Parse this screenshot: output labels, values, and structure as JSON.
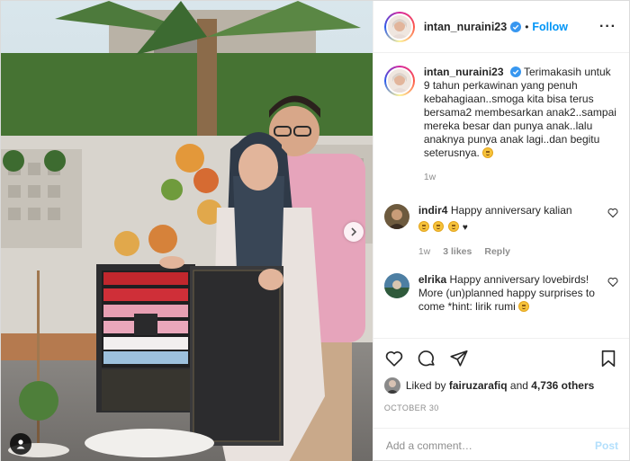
{
  "post": {
    "username": "intan_nuraini23",
    "follow_label": "Follow",
    "dot": "•",
    "more_label": "···",
    "caption": "Terimakasih untuk 9 tahun perkawinan yang penuh kebahagiaan..smoga kita bisa terus bersama2 membesarkan anak2..sampai mereka besar dan punya anak..lalu anaknya punya anak lagi..dan begitu seterusnya.",
    "caption_age": "1w",
    "likes_prefix": "Liked by",
    "likes_user": "fairuzarafiq",
    "likes_and": "and",
    "likes_count": "4,736 others",
    "date": "OCTOBER 30",
    "comment_placeholder": "Add a comment…",
    "post_label": "Post"
  },
  "comments": [
    {
      "username": "indir4",
      "text": "Happy anniversary kalian",
      "age": "1w",
      "likes": "3 likes",
      "reply": "Reply"
    },
    {
      "username": "elrika",
      "text": "Happy anniversary lovebirds! More (un)planned happy surprises to come *hint: lirik rumi"
    }
  ],
  "icons": {
    "verified": "verified-badge-icon",
    "heart": "heart-icon",
    "comment": "comment-icon",
    "share": "paper-plane-icon",
    "bookmark": "bookmark-icon",
    "next": "chevron-right-icon",
    "tag": "user-tag-icon"
  },
  "colors": {
    "accent": "#0095f6",
    "verified": "#3897f0",
    "muted": "#8e8e8e",
    "post_disabled": "#b2dffc"
  }
}
